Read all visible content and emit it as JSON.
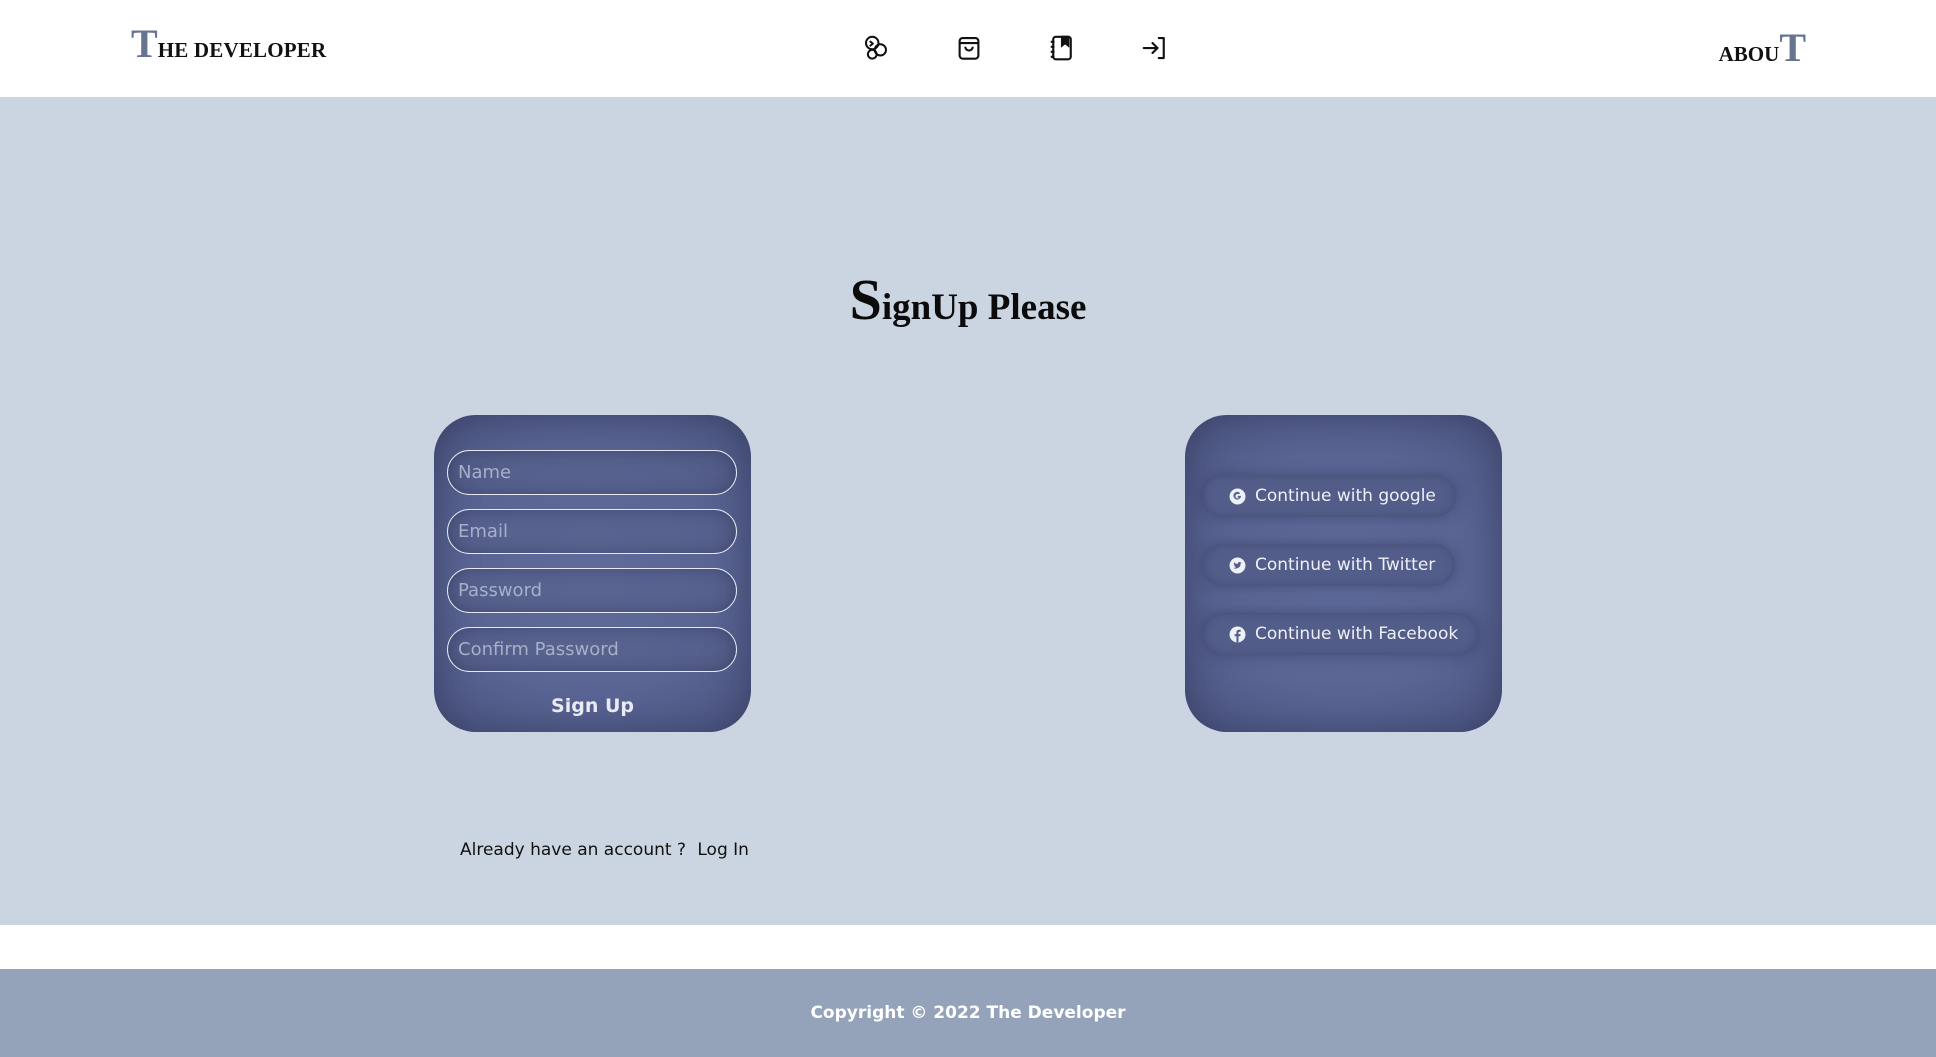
{
  "header": {
    "brand_initial": "T",
    "brand_rest": "HE DEVELOPER",
    "about_rest": "ABOU",
    "about_initial": "T",
    "nav_icons": [
      "projects-icon",
      "shopping-bag-icon",
      "notebook-icon",
      "login-icon"
    ]
  },
  "page": {
    "title_initial": "S",
    "title_rest": "ignUp Please"
  },
  "signup_form": {
    "name_placeholder": "Name",
    "email_placeholder": "Email",
    "password_placeholder": "Password",
    "confirm_placeholder": "Confirm Password",
    "submit_label": "Sign Up",
    "login_prompt": "Already have an account ?",
    "login_link": "Log In"
  },
  "social": {
    "google_label": "Continue with google",
    "twitter_label": "Continue with Twitter",
    "facebook_label": "Continue with Facebook"
  },
  "footer": {
    "copyright": "Copyright © 2022 The Developer"
  },
  "colors": {
    "main_bg": "#cbd4e1",
    "card_bg": "#5a6594",
    "footer_bg": "#94a3ba",
    "accent_letter": "#66748f"
  }
}
